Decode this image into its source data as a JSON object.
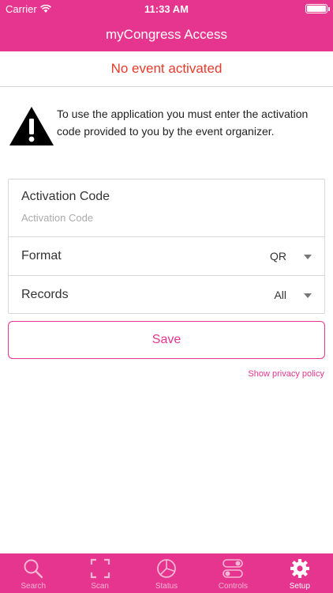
{
  "status_bar": {
    "carrier": "Carrier",
    "time": "11:33 AM"
  },
  "nav": {
    "title": "myCongress Access"
  },
  "banner": {
    "text": "No event activated"
  },
  "notice": {
    "text": "To use the application you must enter the activation code provided to you by the event organizer."
  },
  "form": {
    "activation": {
      "label": "Activation Code",
      "placeholder": "Activation Code"
    },
    "format": {
      "label": "Format",
      "value": "QR"
    },
    "records": {
      "label": "Records",
      "value": "All"
    }
  },
  "save": {
    "label": "Save"
  },
  "privacy": {
    "label": "Show privacy policy"
  },
  "tabs": [
    {
      "label": "Search",
      "icon": "search-icon"
    },
    {
      "label": "Scan",
      "icon": "scan-icon"
    },
    {
      "label": "Status",
      "icon": "status-pie-icon"
    },
    {
      "label": "Controls",
      "icon": "toggles-icon"
    },
    {
      "label": "Setup",
      "icon": "gear-icon",
      "active": true
    }
  ],
  "colors": {
    "brand": "#e6358f",
    "alert": "#e83a2c"
  }
}
